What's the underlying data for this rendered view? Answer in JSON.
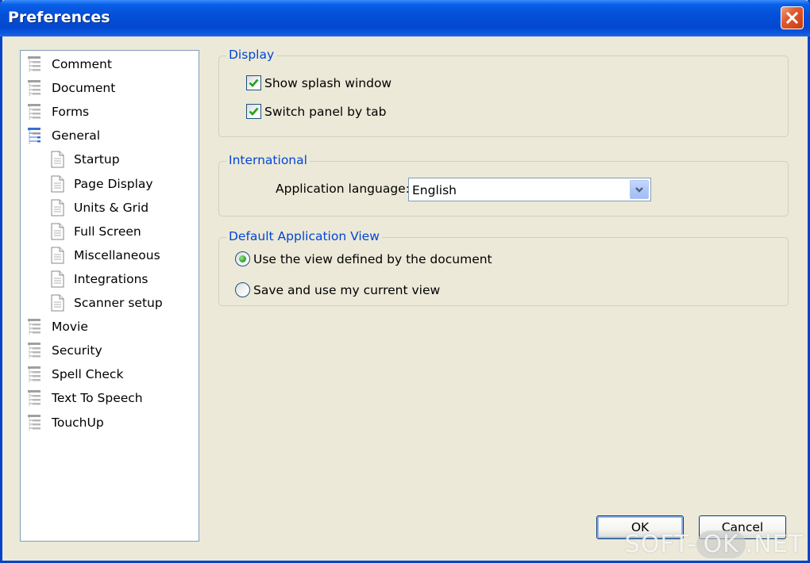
{
  "window": {
    "title": "Preferences"
  },
  "tree": {
    "items": [
      {
        "label": "Comment",
        "icon": "tree-node-icon",
        "level": 0
      },
      {
        "label": "Document",
        "icon": "tree-node-icon",
        "level": 0
      },
      {
        "label": "Forms",
        "icon": "tree-node-icon",
        "level": 0
      },
      {
        "label": "General",
        "icon": "tree-node-expanded-icon",
        "level": 0
      },
      {
        "label": "Startup",
        "icon": "page-icon",
        "level": 1
      },
      {
        "label": "Page Display",
        "icon": "page-icon",
        "level": 1
      },
      {
        "label": "Units & Grid",
        "icon": "page-icon",
        "level": 1
      },
      {
        "label": "Full Screen",
        "icon": "page-icon",
        "level": 1
      },
      {
        "label": "Miscellaneous",
        "icon": "page-icon",
        "level": 1
      },
      {
        "label": "Integrations",
        "icon": "page-icon",
        "level": 1
      },
      {
        "label": "Scanner setup",
        "icon": "page-icon",
        "level": 1
      },
      {
        "label": "Movie",
        "icon": "tree-node-icon",
        "level": 0
      },
      {
        "label": "Security",
        "icon": "tree-node-icon",
        "level": 0
      },
      {
        "label": "Spell Check",
        "icon": "tree-node-icon",
        "level": 0
      },
      {
        "label": "Text To Speech",
        "icon": "tree-node-icon",
        "level": 0
      },
      {
        "label": "TouchUp",
        "icon": "tree-node-icon",
        "level": 0
      }
    ]
  },
  "display": {
    "legend": "Display",
    "show_splash": {
      "label": "Show splash window",
      "checked": true
    },
    "switch_panel": {
      "label": "Switch panel by tab",
      "checked": true
    }
  },
  "international": {
    "legend": "International",
    "language_label": "Application language:",
    "language_value": "English"
  },
  "default_view": {
    "legend": "Default Application View",
    "option_document": {
      "label": "Use the view defined by the document",
      "selected": true
    },
    "option_current": {
      "label": "Save and use my current view",
      "selected": false
    }
  },
  "buttons": {
    "ok": "OK",
    "cancel": "Cancel"
  },
  "watermark": {
    "part1": "SOFT-",
    "part2": "OK",
    "part3": ".NET"
  },
  "colors": {
    "titlebar": "#0450d8",
    "legend": "#0046d5",
    "close": "#e05a30"
  }
}
